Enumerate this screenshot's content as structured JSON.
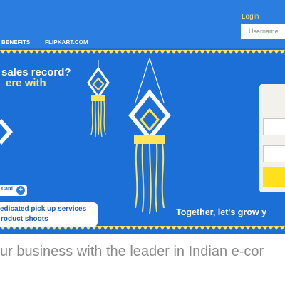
{
  "header": {
    "nav_items": [
      "BENEFITS",
      "FLIPKART.COM"
    ],
    "login_label": "Login",
    "username_placeholder": "Username"
  },
  "banner": {
    "headline_line1": "sales record?",
    "headline_line2": "ere with",
    "card_badge": "Card",
    "services_line1": "edicated pick up services",
    "services_line2": "roduct shoots",
    "tagline": "Together, let's grow y"
  },
  "bottom_text": "ur business with the leader in Indian e-cor",
  "colors": {
    "header_blue": "#2b7de0",
    "banner_blue": "#1d6fd8",
    "accent_yellow": "#ffe45c",
    "button_yellow": "#ffe11b"
  }
}
